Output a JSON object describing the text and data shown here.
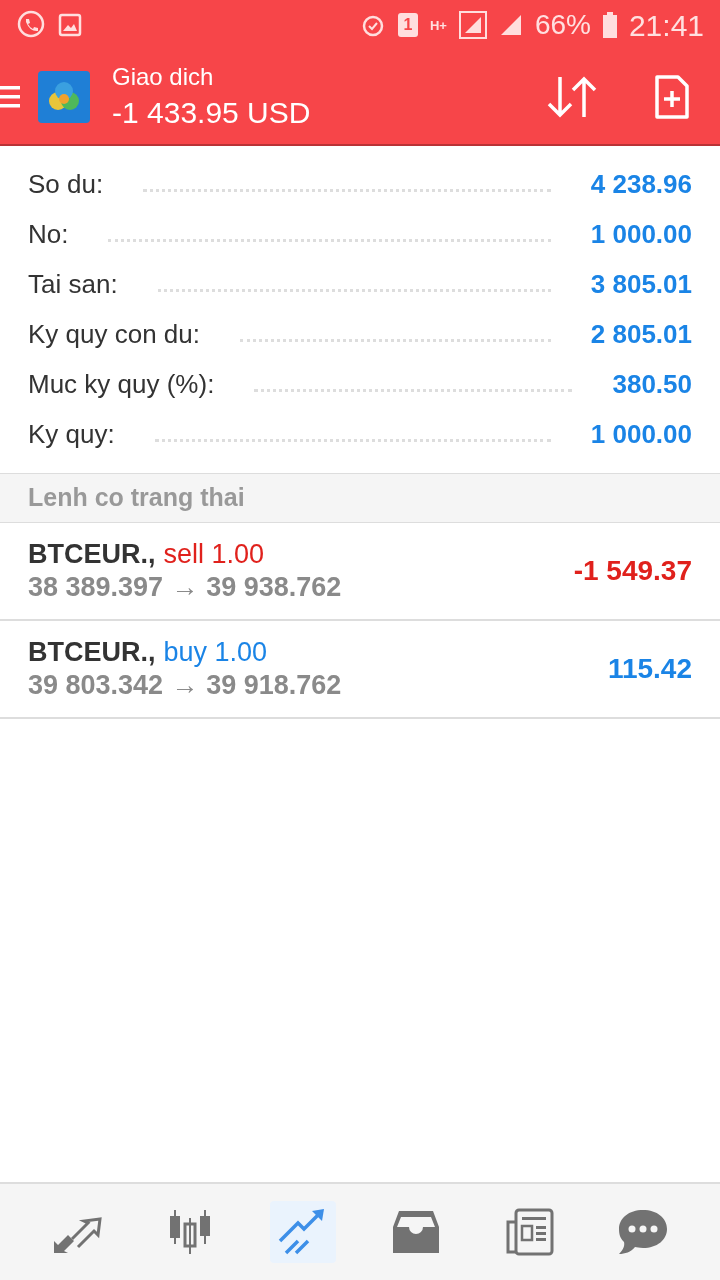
{
  "status_bar": {
    "sim": "1",
    "network": "H+",
    "battery": "66%",
    "time": "21:41"
  },
  "header": {
    "title": "Giao dich",
    "balance": "-1 433.95 USD"
  },
  "summary": [
    {
      "label": "So du:",
      "value": "4 238.96"
    },
    {
      "label": "No:",
      "value": "1 000.00"
    },
    {
      "label": "Tai san:",
      "value": "3 805.01"
    },
    {
      "label": "Ky quy con du:",
      "value": "2 805.01"
    },
    {
      "label": "Muc ky quy (%):",
      "value": "380.50"
    },
    {
      "label": "Ky quy:",
      "value": "1 000.00"
    }
  ],
  "section_title": "Lenh co trang thai",
  "positions": [
    {
      "symbol": "BTCEUR.,",
      "kind": "sell",
      "action": "sell 1.00",
      "open": "38 389.397",
      "arrow": "→",
      "current": "39 938.762",
      "profit": "-1 549.37",
      "loss": true
    },
    {
      "symbol": "BTCEUR.,",
      "kind": "buy",
      "action": "buy 1.00",
      "open": "39 803.342",
      "arrow": "→",
      "current": "39 918.762",
      "profit": "115.42",
      "loss": false
    }
  ],
  "nav": [
    {
      "kind": "quotes",
      "selected": false
    },
    {
      "kind": "chart",
      "selected": false
    },
    {
      "kind": "trade",
      "selected": true
    },
    {
      "kind": "inbox",
      "selected": false
    },
    {
      "kind": "news",
      "selected": false
    },
    {
      "kind": "chat",
      "selected": false
    }
  ]
}
